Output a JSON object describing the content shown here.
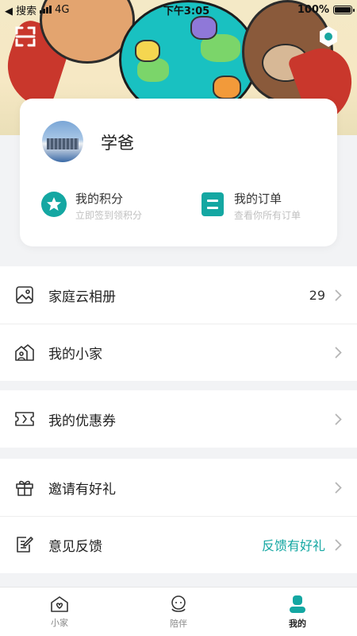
{
  "status_bar": {
    "back_label": "◀ 搜索",
    "network": "4G",
    "time": "下午3:05",
    "battery": "100%"
  },
  "profile": {
    "username": "学爸",
    "actions": [
      {
        "title": "我的积分",
        "subtitle": "立即签到领积分",
        "icon": "star-badge-icon"
      },
      {
        "title": "我的订单",
        "subtitle": "查看你所有订单",
        "icon": "order-list-icon"
      }
    ]
  },
  "menu": {
    "group1": [
      {
        "label": "家庭云相册",
        "value": "29",
        "icon": "photo-album-icon"
      },
      {
        "label": "我的小家",
        "value": "",
        "icon": "home-icon"
      }
    ],
    "group2": [
      {
        "label": "我的优惠券",
        "value": "",
        "icon": "coupon-icon"
      }
    ],
    "group3": [
      {
        "label": "邀请有好礼",
        "value": "",
        "icon": "gift-icon"
      },
      {
        "label": "意见反馈",
        "value": "反馈有好礼",
        "icon": "feedback-icon"
      }
    ]
  },
  "tabs": [
    {
      "label": "小家",
      "icon": "heart-home-icon",
      "active": false
    },
    {
      "label": "陪伴",
      "icon": "companion-icon",
      "active": false
    },
    {
      "label": "我的",
      "icon": "profile-icon",
      "active": true
    }
  ],
  "colors": {
    "accent": "#14a7a2",
    "page_bg": "#f2f3f5",
    "value_accent": "#14a7a2"
  }
}
